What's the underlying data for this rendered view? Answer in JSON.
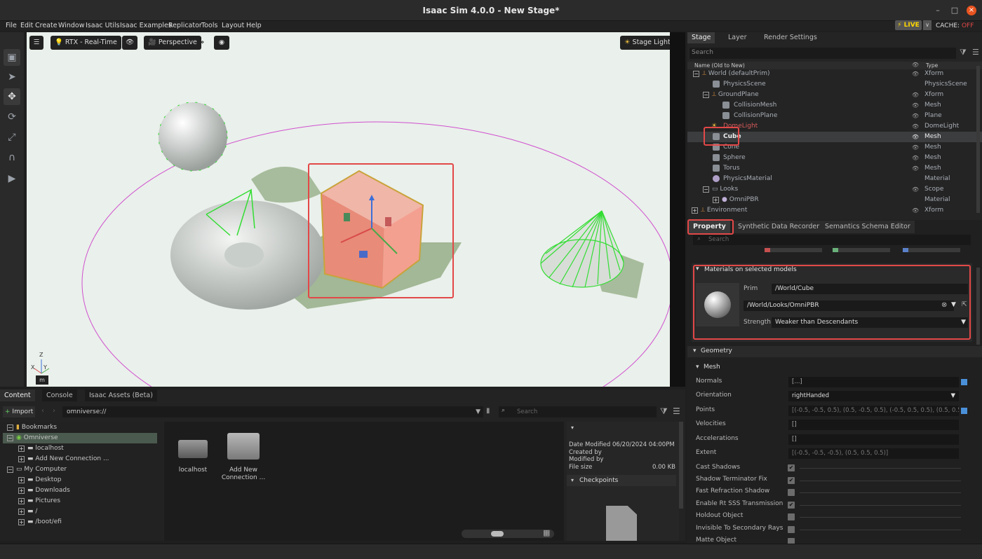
{
  "window": {
    "title": "Isaac Sim 4.0.0 - New Stage*",
    "min": "–",
    "max": "□",
    "close": "×"
  },
  "menu": [
    "File",
    "Edit",
    "Create",
    "Window",
    "Isaac Utils",
    "Isaac Examples",
    "Replicator",
    "Tools",
    "Layout",
    "Help"
  ],
  "status": {
    "live": "⚡ LIVE",
    "live_dd": "∨",
    "cache_label": "CACHE:",
    "cache_value": "OFF"
  },
  "viewport": {
    "settings_icon": "☰",
    "renderer": "RTX - Real-Time",
    "camera": "Perspective",
    "lights": "Stage Lights",
    "axis_label": "m",
    "axis_x": "X",
    "axis_y": "Y",
    "axis_z": "Z"
  },
  "stage": {
    "tabs": [
      "Stage",
      "Layer",
      "Render Settings"
    ],
    "search_placeholder": "Search",
    "col_name": "Name (Old to New)",
    "col_type": "Type",
    "rows": [
      {
        "name": "World (defaultPrim)",
        "type": "Xform"
      },
      {
        "name": "PhysicsScene",
        "type": "PhysicsScene"
      },
      {
        "name": "GroundPlane",
        "type": "Xform"
      },
      {
        "name": "CollisionMesh",
        "type": "Mesh"
      },
      {
        "name": "CollisionPlane",
        "type": "Plane"
      },
      {
        "name": "DomeLight",
        "type": "DomeLight"
      },
      {
        "name": "Cube",
        "type": "Mesh"
      },
      {
        "name": "Cone",
        "type": "Mesh"
      },
      {
        "name": "Sphere",
        "type": "Mesh"
      },
      {
        "name": "Torus",
        "type": "Mesh"
      },
      {
        "name": "PhysicsMaterial",
        "type": "Material"
      },
      {
        "name": "Looks",
        "type": "Scope"
      },
      {
        "name": "OmniPBR",
        "type": "Material"
      },
      {
        "name": "Environment",
        "type": "Xform"
      }
    ]
  },
  "property": {
    "tabs": [
      "Property",
      "Synthetic Data Recorder",
      "Semantics Schema Editor"
    ],
    "search_placeholder": "Search",
    "materials": {
      "header": "Materials on selected models",
      "prim_label": "Prim",
      "prim_value": "/World/Cube",
      "material_value": "/World/Looks/OmniPBR",
      "strength_label": "Strength",
      "strength_value": "Weaker than Descendants"
    },
    "geometry_header": "Geometry",
    "mesh_header": "Mesh",
    "fields": [
      {
        "label": "Normals",
        "value": "[...]"
      },
      {
        "label": "Orientation",
        "value": "rightHanded"
      },
      {
        "label": "Points",
        "value": "[(-0.5, -0.5, 0.5), (0.5, -0.5, 0.5), (-0.5, 0.5, 0.5), (0.5, 0.5, 0.5), (-0.5, 0.5"
      },
      {
        "label": "Velocities",
        "value": "[]"
      },
      {
        "label": "Accelerations",
        "value": "[]"
      },
      {
        "label": "Extent",
        "value": "[(-0.5, -0.5, -0.5), (0.5, 0.5, 0.5)]"
      }
    ],
    "checks": [
      {
        "label": "Cast Shadows",
        "checked": true
      },
      {
        "label": "Shadow Terminator Fix",
        "checked": true
      },
      {
        "label": "Fast Refraction Shadow",
        "checked": false
      },
      {
        "label": "Enable Rt SSS Transmission",
        "checked": true
      },
      {
        "label": "Holdout Object",
        "checked": false
      },
      {
        "label": "Invisible To Secondary Rays",
        "checked": false
      },
      {
        "label": "Matte Object",
        "checked": false
      }
    ]
  },
  "content": {
    "tabs": [
      "Content",
      "Console",
      "Isaac Assets (Beta)"
    ],
    "import_label": "Import",
    "path": "omniverse://",
    "search_placeholder": "Search",
    "tree": [
      "Bookmarks",
      "Omniverse",
      "localhost",
      "Add New Connection ...",
      "My Computer",
      "Desktop",
      "Downloads",
      "Pictures",
      "/",
      "/boot/efi"
    ],
    "grid": [
      {
        "label": "localhost"
      },
      {
        "label": "Add New Connection ..."
      }
    ],
    "details": {
      "date_modified_label": "Date Modified",
      "date_modified": "06/20/2024 04:00PM",
      "created_by": "Created by",
      "modified_by": "Modified by",
      "file_size_label": "File size",
      "file_size": "0.00 KB",
      "checkpoints": "Checkpoints"
    }
  }
}
